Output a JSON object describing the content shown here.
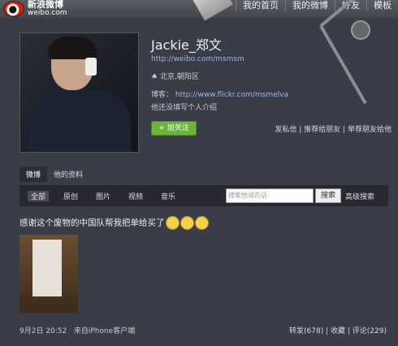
{
  "header": {
    "logo_cn": "新浪微博",
    "logo_en": "weibo.com",
    "nav": [
      "我的首页",
      "我的微博",
      "好友",
      "模板"
    ]
  },
  "profile": {
    "name": "Jackie_郑文",
    "url": "http://weibo.com/msmsm",
    "location": "北京,朝阳区",
    "blog_label": "博客：",
    "blog_url": "http://www.flickr.com/msmelva",
    "intro": "他还没填写个人介绍",
    "follow_label": "+ 加关注",
    "actions": [
      "发私信",
      "推荐给朋友",
      "举荐朋友给他"
    ]
  },
  "tabs": [
    "微博",
    "他的资料"
  ],
  "filters": [
    "全部",
    "原创",
    "图片",
    "视频",
    "音乐"
  ],
  "search": {
    "placeholder": "搜索他说的话",
    "button": "搜索",
    "advanced": "高级搜索"
  },
  "post": {
    "text": "感谢这个废物的中国队帮我把单给买了",
    "time": "9月2日 20:52",
    "source": "来自iPhone客户端",
    "actions": [
      "转发(678)",
      "收藏",
      "评论(229)"
    ]
  },
  "colors": {
    "background": "#3a3c47",
    "link": "#9db8e6",
    "follow_button": "#6ab43a"
  },
  "icons": [
    "weibo-logo-icon",
    "location-icon",
    "emoticon-icon"
  ]
}
